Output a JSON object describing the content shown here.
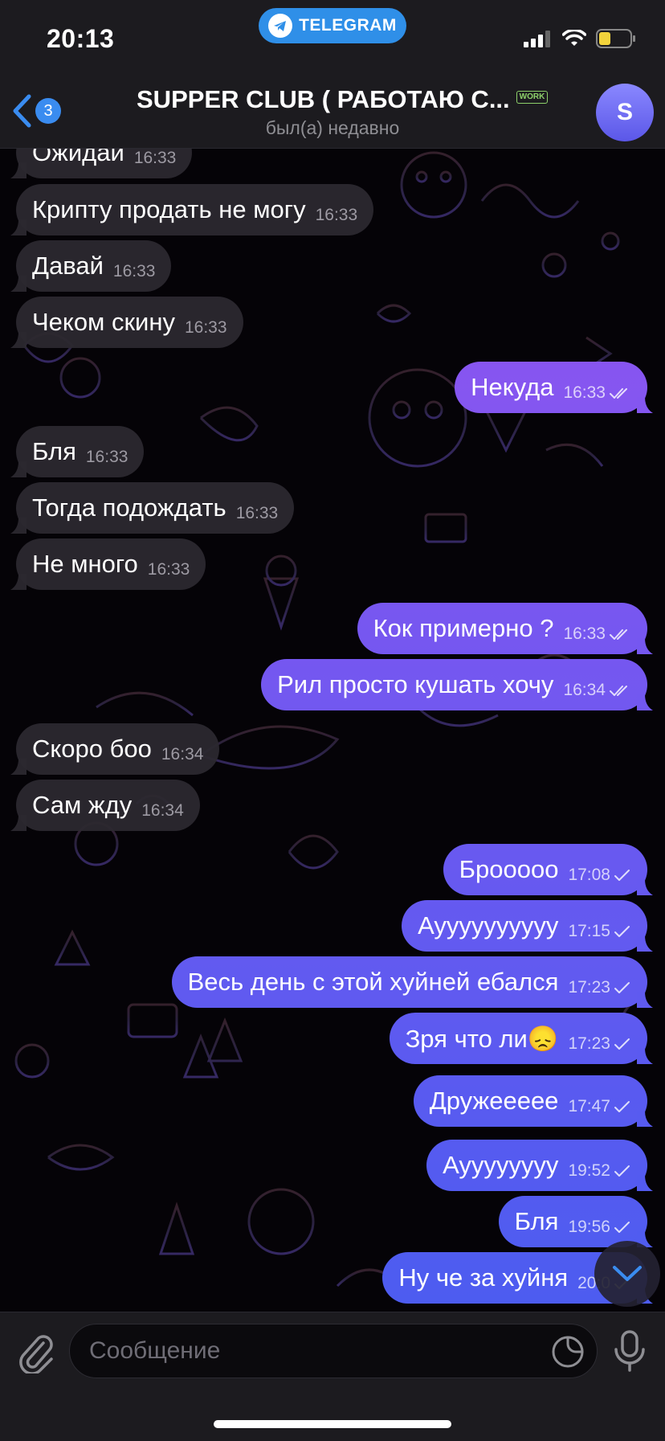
{
  "status_bar": {
    "time": "20:13",
    "pill_label": "TELEGRAM"
  },
  "header": {
    "back_badge": "3",
    "title": "SUPPER CLUB ( РАБОТАЮ С...",
    "title_badge": "WORK",
    "subtitle": "был(а) недавно",
    "avatar_letter": "S"
  },
  "colors": {
    "out_top": "#8a55f0",
    "out_bottom": "#4d5cf0",
    "incoming": "#2c2830",
    "accent": "#2f8fe8"
  },
  "messages": [
    {
      "dir": "in",
      "text": "Ожидай",
      "time": "16:33"
    },
    {
      "dir": "in",
      "text": "Крипту продать не могу",
      "time": "16:33"
    },
    {
      "dir": "in",
      "text": "Давай",
      "time": "16:33"
    },
    {
      "dir": "in",
      "text": "Чеком скину",
      "time": "16:33"
    },
    {
      "dir": "out",
      "text": "Некуда",
      "time": "16:33",
      "status": "read"
    },
    {
      "dir": "in",
      "text": "Бля",
      "time": "16:33"
    },
    {
      "dir": "in",
      "text": "Тогда подождать",
      "time": "16:33"
    },
    {
      "dir": "in",
      "text": "Не много",
      "time": "16:33"
    },
    {
      "dir": "out",
      "text": "Кок примерно ?",
      "time": "16:33",
      "status": "read"
    },
    {
      "dir": "out",
      "text": "Рил просто кушать хочу",
      "time": "16:34",
      "status": "read"
    },
    {
      "dir": "in",
      "text": "Скоро боо",
      "time": "16:34"
    },
    {
      "dir": "in",
      "text": "Сам жду",
      "time": "16:34"
    },
    {
      "dir": "out",
      "text": "Брооооо",
      "time": "17:08",
      "status": "sent"
    },
    {
      "dir": "out",
      "text": "Ауууууууууу",
      "time": "17:15",
      "status": "sent"
    },
    {
      "dir": "out",
      "text": "Весь день с этой хуйней ебался",
      "time": "17:23",
      "status": "sent"
    },
    {
      "dir": "out",
      "text": "Зря что ли😞",
      "time": "17:23",
      "status": "sent"
    },
    {
      "dir": "out",
      "text": "Дружеееее",
      "time": "17:47",
      "status": "sent"
    },
    {
      "dir": "out",
      "text": "Ауууууууу",
      "time": "19:52",
      "status": "sent"
    },
    {
      "dir": "out",
      "text": "Бля",
      "time": "19:56",
      "status": "sent"
    },
    {
      "dir": "out",
      "text": "Ну че за хуйня",
      "time": "20:0",
      "status": "sent"
    }
  ],
  "input": {
    "placeholder": "Сообщение"
  }
}
